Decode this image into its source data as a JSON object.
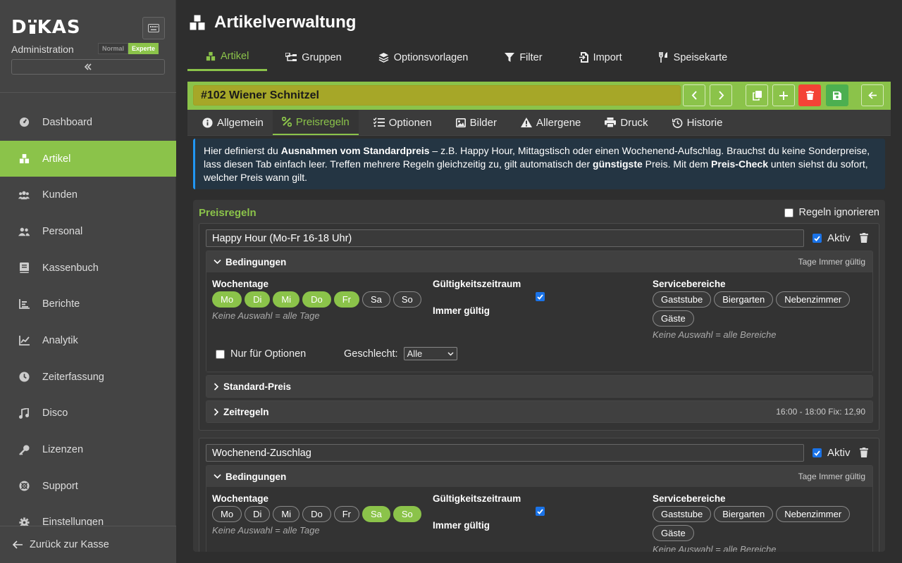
{
  "sidebar": {
    "logo": "DKAS",
    "subtitle": "Administration",
    "mode_normal": "Normal",
    "mode_expert": "Experte",
    "nav": [
      {
        "label": "Dashboard",
        "icon": "dashboard-icon"
      },
      {
        "label": "Artikel",
        "icon": "boxes-icon",
        "active": true
      },
      {
        "label": "Kunden",
        "icon": "users-icon"
      },
      {
        "label": "Personal",
        "icon": "user-friends-icon"
      },
      {
        "label": "Kassenbuch",
        "icon": "book-icon"
      },
      {
        "label": "Berichte",
        "icon": "bar-chart-icon"
      },
      {
        "label": "Analytik",
        "icon": "line-chart-icon"
      },
      {
        "label": "Zeiterfassung",
        "icon": "clock-icon"
      },
      {
        "label": "Disco",
        "icon": "music-icon"
      },
      {
        "label": "Lizenzen",
        "icon": "key-icon"
      },
      {
        "label": "Support",
        "icon": "lifebuoy-icon"
      },
      {
        "label": "Einstellungen",
        "icon": "gear-icon"
      }
    ],
    "back_label": "Zurück zur Kasse"
  },
  "header": {
    "title": "Artikelverwaltung",
    "tabs": [
      {
        "label": "Artikel",
        "active": true
      },
      {
        "label": "Gruppen"
      },
      {
        "label": "Optionsvorlagen"
      },
      {
        "label": "Filter"
      },
      {
        "label": "Import"
      },
      {
        "label": "Speisekarte"
      }
    ]
  },
  "article": {
    "name": "#102 Wiener Schnitzel"
  },
  "subtabs": [
    {
      "label": "Allgemein"
    },
    {
      "label": "Preisregeln",
      "active": true
    },
    {
      "label": "Optionen"
    },
    {
      "label": "Bilder"
    },
    {
      "label": "Allergene"
    },
    {
      "label": "Druck"
    },
    {
      "label": "Historie"
    }
  ],
  "info": {
    "t1": "Hier definierst du ",
    "b1": "Ausnahmen vom Standardpreis",
    "t2": " – z.B. Happy Hour, Mittagstisch oder einen Wochenend-Aufschlag. Brauchst du keine Sonderpreise, lass diesen Tab einfach leer. Treffen mehrere Regeln gleichzeitig zu, gilt automatisch der ",
    "b2": "günstigste",
    "t3": " Preis. Mit dem ",
    "b3": "Preis-Check",
    "t4": " unten siehst du sofort, welcher Preis wann gilt."
  },
  "panel": {
    "title": "Preisregeln",
    "ignore_label": "Regeln ignorieren",
    "rules": [
      {
        "name": "Happy Hour (Mo-Fr 16-18 Uhr)",
        "aktiv_label": "Aktiv",
        "conditions_label": "Bedingungen",
        "conditions_summary": "Tage Immer gültig",
        "weekdays_label": "Wochentage",
        "days": [
          {
            "label": "Mo",
            "on": true
          },
          {
            "label": "Di",
            "on": true
          },
          {
            "label": "Mi",
            "on": true
          },
          {
            "label": "Do",
            "on": true
          },
          {
            "label": "Fr",
            "on": true
          },
          {
            "label": "Sa",
            "on": false
          },
          {
            "label": "So",
            "on": false
          }
        ],
        "days_hint": "Keine Auswahl = alle Tage",
        "validity_label": "Gültigkeitszeitraum",
        "always_label": "Immer gültig",
        "service_label": "Servicebereiche",
        "areas": [
          "Gaststube",
          "Biergarten",
          "Nebenzimmer",
          "Gäste"
        ],
        "areas_hint": "Keine Auswahl = alle Bereiche",
        "only_options_label": "Nur für Optionen",
        "gender_label": "Geschlecht:",
        "gender_value": "Alle",
        "standard_price_label": "Standard-Preis",
        "time_rules_label": "Zeitregeln",
        "time_rules_summary": "16:00 - 18:00 Fix: 12,90"
      },
      {
        "name": "Wochenend-Zuschlag",
        "aktiv_label": "Aktiv",
        "conditions_label": "Bedingungen",
        "conditions_summary": "Tage Immer gültig",
        "weekdays_label": "Wochentage",
        "days": [
          {
            "label": "Mo",
            "on": false
          },
          {
            "label": "Di",
            "on": false
          },
          {
            "label": "Mi",
            "on": false
          },
          {
            "label": "Do",
            "on": false
          },
          {
            "label": "Fr",
            "on": false
          },
          {
            "label": "Sa",
            "on": true
          },
          {
            "label": "So",
            "on": true
          }
        ],
        "days_hint": "Keine Auswahl = alle Tage",
        "validity_label": "Gültigkeitszeitraum",
        "always_label": "Immer gültig",
        "service_label": "Servicebereiche",
        "areas": [
          "Gaststube",
          "Biergarten",
          "Nebenzimmer",
          "Gäste"
        ],
        "areas_hint": "Keine Auswahl = alle Bereiche"
      }
    ]
  },
  "colors": {
    "accent": "#8bc34a",
    "danger": "#f44336",
    "save": "#4caf50",
    "info": "#2196f3"
  }
}
